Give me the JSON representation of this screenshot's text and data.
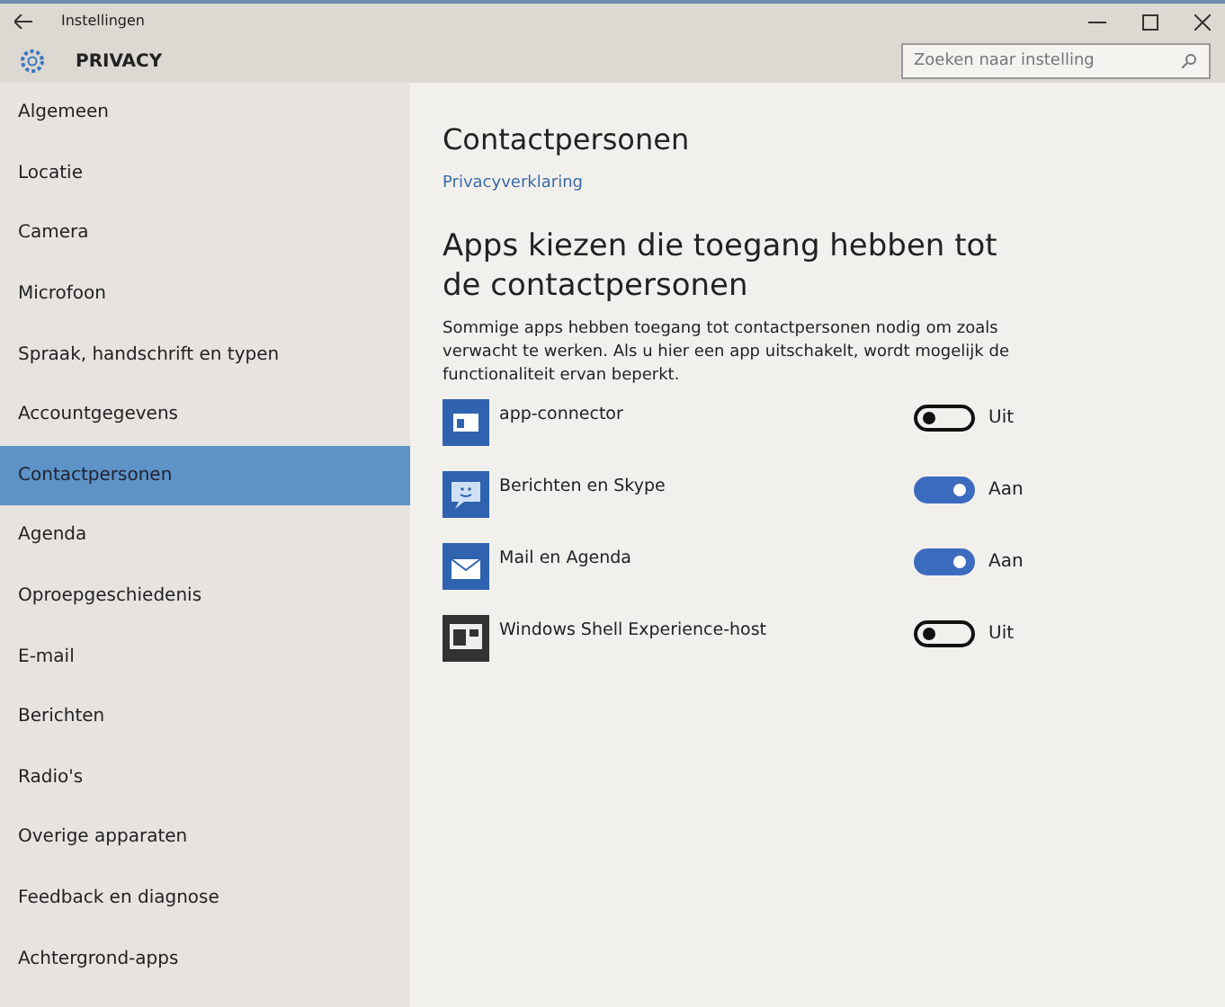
{
  "window": {
    "title": "Instellingen",
    "section": "PRIVACY"
  },
  "search": {
    "placeholder": "Zoeken naar instelling"
  },
  "sidebar": {
    "items": [
      {
        "label": "Algemeen",
        "selected": false
      },
      {
        "label": "Locatie",
        "selected": false
      },
      {
        "label": "Camera",
        "selected": false
      },
      {
        "label": "Microfoon",
        "selected": false
      },
      {
        "label": "Spraak, handschrift en typen",
        "selected": false
      },
      {
        "label": "Accountgegevens",
        "selected": false
      },
      {
        "label": "Contactpersonen",
        "selected": true
      },
      {
        "label": "Agenda",
        "selected": false
      },
      {
        "label": "Oproepgeschiedenis",
        "selected": false
      },
      {
        "label": "E-mail",
        "selected": false
      },
      {
        "label": "Berichten",
        "selected": false
      },
      {
        "label": "Radio's",
        "selected": false
      },
      {
        "label": "Overige apparaten",
        "selected": false
      },
      {
        "label": "Feedback en diagnose",
        "selected": false
      },
      {
        "label": "Achtergrond-apps",
        "selected": false
      }
    ]
  },
  "content": {
    "title": "Contactpersonen",
    "link": "Privacyverklaring",
    "subtitle": "Apps kiezen die toegang hebben tot de contactpersonen",
    "description": "Sommige apps hebben toegang tot contactpersonen nodig om zoals verwacht te werken. Als u hier een app uitschakelt, wordt mogelijk de functionaliteit ervan beperkt.",
    "apps": [
      {
        "name": "app-connector",
        "kind": "window",
        "on": false,
        "state": "Uit"
      },
      {
        "name": "Berichten en Skype",
        "kind": "chat",
        "on": true,
        "state": "Aan"
      },
      {
        "name": "Mail en Agenda",
        "kind": "mail",
        "on": true,
        "state": "Aan"
      },
      {
        "name": "Windows Shell Experience-host",
        "kind": "shell",
        "on": false,
        "state": "Uit"
      }
    ]
  }
}
